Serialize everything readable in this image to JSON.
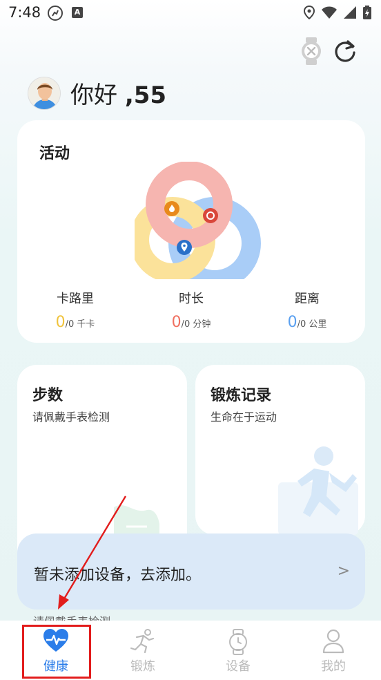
{
  "status_bar": {
    "time": "7:48",
    "icons": [
      "running-icon",
      "a-icon",
      "location-icon",
      "wifi-icon",
      "signal-icon",
      "battery-icon"
    ]
  },
  "header": {
    "greeting": "你好",
    "name": ",55"
  },
  "activity": {
    "title": "活动",
    "stats": [
      {
        "label": "卡路里",
        "value": "0",
        "unit": "/0 千卡",
        "color": "#f0c33c"
      },
      {
        "label": "时长",
        "value": "0",
        "unit": "/0 分钟",
        "color": "#f07060"
      },
      {
        "label": "距离",
        "value": "0",
        "unit": "/0 公里",
        "color": "#5aa0f0"
      }
    ]
  },
  "steps": {
    "title": "步数",
    "subtitle": "请佩戴手表检测",
    "peek_text": "请佩戴手表检测"
  },
  "exercise": {
    "title": "锻炼记录",
    "subtitle": "生命在于运动"
  },
  "add_device": {
    "text": "暂未添加设备，去添加。",
    "chevron": ">"
  },
  "bottom_nav": [
    {
      "label": "健康",
      "icon": "heart-pulse-icon",
      "active": true
    },
    {
      "label": "锻炼",
      "icon": "running-icon",
      "active": false
    },
    {
      "label": "设备",
      "icon": "watch-icon",
      "active": false
    },
    {
      "label": "我的",
      "icon": "person-icon",
      "active": false
    }
  ],
  "colors": {
    "accent": "#2b7de9",
    "annotation": "#e21c1c",
    "ring_red": "#f6b5b0",
    "ring_yellow": "#fbe29a",
    "ring_blue": "#a9cdf7"
  }
}
